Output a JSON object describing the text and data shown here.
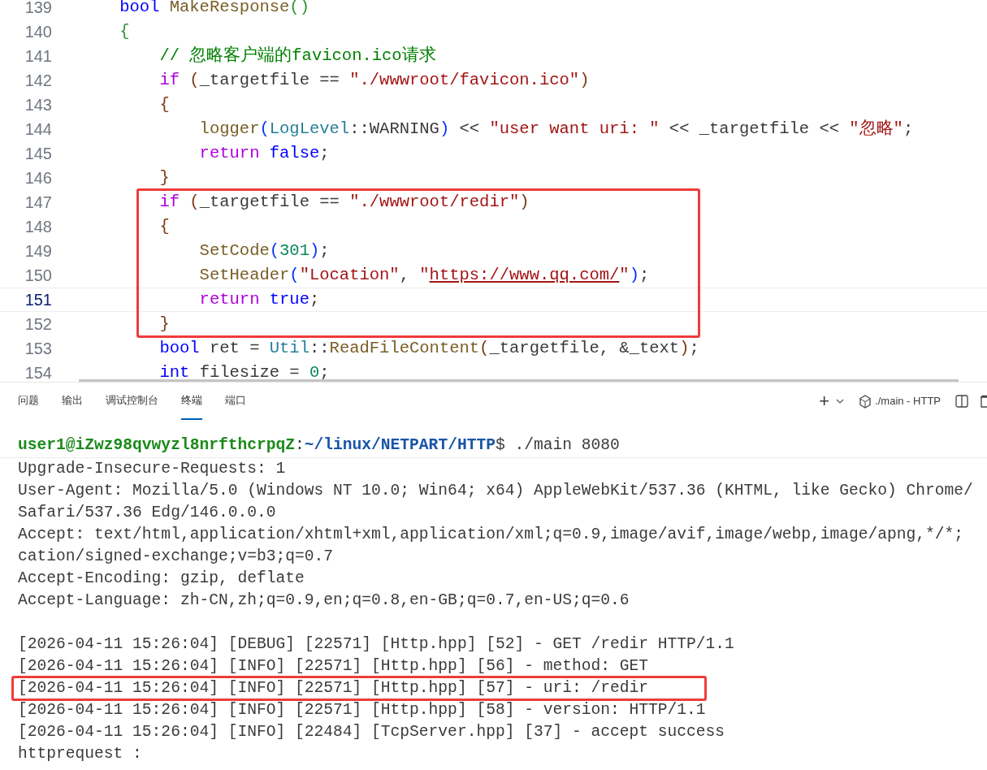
{
  "editor": {
    "lines": [
      {
        "number": "139",
        "current": false,
        "boxed": false,
        "tokens": [
          {
            "text": "    bool ",
            "kind": "keyword"
          },
          {
            "text": "MakeResponse",
            "kind": "function"
          },
          {
            "text": "()",
            "kind": "bracket-green"
          }
        ]
      },
      {
        "number": "140",
        "current": false,
        "boxed": false,
        "tokens": [
          {
            "text": "    {",
            "kind": "bracket-green"
          }
        ]
      },
      {
        "number": "141",
        "current": false,
        "boxed": false,
        "tokens": [
          {
            "text": "        // 忽略客户端的favicon.ico请求",
            "kind": "comment"
          }
        ]
      },
      {
        "number": "142",
        "current": false,
        "boxed": false,
        "tokens": [
          {
            "text": "        if ",
            "kind": "control"
          },
          {
            "text": "(",
            "kind": "bracket-brown"
          },
          {
            "text": "_targetfile == ",
            "kind": "plain"
          },
          {
            "text": "\"./wwwroot/favicon.ico\"",
            "kind": "string"
          },
          {
            "text": ")",
            "kind": "bracket-brown"
          }
        ]
      },
      {
        "number": "143",
        "current": false,
        "boxed": false,
        "tokens": [
          {
            "text": "        {",
            "kind": "bracket-brown"
          }
        ]
      },
      {
        "number": "144",
        "current": false,
        "boxed": false,
        "tokens": [
          {
            "text": "            logger",
            "kind": "function"
          },
          {
            "text": "(",
            "kind": "bracket-blue"
          },
          {
            "text": "LogLevel",
            "kind": "class"
          },
          {
            "text": "::WARNING",
            "kind": "plain"
          },
          {
            "text": ")",
            "kind": "bracket-blue"
          },
          {
            "text": " << ",
            "kind": "plain"
          },
          {
            "text": "\"user want uri: \"",
            "kind": "string"
          },
          {
            "text": " << _targetfile << ",
            "kind": "plain"
          },
          {
            "text": "\"忽略\"",
            "kind": "string"
          },
          {
            "text": ";",
            "kind": "plain"
          }
        ]
      },
      {
        "number": "145",
        "current": false,
        "boxed": false,
        "tokens": [
          {
            "text": "            return ",
            "kind": "control"
          },
          {
            "text": "false",
            "kind": "keyword"
          },
          {
            "text": ";",
            "kind": "plain"
          }
        ]
      },
      {
        "number": "146",
        "current": false,
        "boxed": false,
        "tokens": [
          {
            "text": "        }",
            "kind": "bracket-brown"
          }
        ]
      },
      {
        "number": "147",
        "current": false,
        "boxed": true,
        "tokens": [
          {
            "text": "        if ",
            "kind": "control"
          },
          {
            "text": "(",
            "kind": "bracket-brown"
          },
          {
            "text": "_targetfile == ",
            "kind": "plain"
          },
          {
            "text": "\"./wwwroot/redir\"",
            "kind": "string"
          },
          {
            "text": ")",
            "kind": "bracket-brown"
          }
        ]
      },
      {
        "number": "148",
        "current": false,
        "boxed": true,
        "tokens": [
          {
            "text": "        {",
            "kind": "bracket-brown"
          }
        ]
      },
      {
        "number": "149",
        "current": false,
        "boxed": true,
        "tokens": [
          {
            "text": "            SetCode",
            "kind": "function"
          },
          {
            "text": "(",
            "kind": "bracket-blue"
          },
          {
            "text": "301",
            "kind": "number"
          },
          {
            "text": ")",
            "kind": "bracket-blue"
          },
          {
            "text": ";",
            "kind": "plain"
          }
        ]
      },
      {
        "number": "150",
        "current": false,
        "boxed": true,
        "tokens": [
          {
            "text": "            SetHeader",
            "kind": "function"
          },
          {
            "text": "(",
            "kind": "bracket-blue"
          },
          {
            "text": "\"Location\"",
            "kind": "string"
          },
          {
            "text": ", ",
            "kind": "plain"
          },
          {
            "text": "\"",
            "kind": "string"
          },
          {
            "text": "https://www.qq.com/",
            "kind": "link"
          },
          {
            "text": "\"",
            "kind": "string"
          },
          {
            "text": ")",
            "kind": "bracket-blue"
          },
          {
            "text": ";",
            "kind": "plain"
          }
        ]
      },
      {
        "number": "151",
        "current": true,
        "boxed": true,
        "tokens": [
          {
            "text": "            return ",
            "kind": "control"
          },
          {
            "text": "true",
            "kind": "keyword"
          },
          {
            "text": ";",
            "kind": "plain"
          }
        ]
      },
      {
        "number": "152",
        "current": false,
        "boxed": true,
        "tokens": [
          {
            "text": "        }",
            "kind": "bracket-brown"
          }
        ]
      },
      {
        "number": "153",
        "current": false,
        "boxed": false,
        "tokens": [
          {
            "text": "        bool",
            "kind": "keyword"
          },
          {
            "text": " ret = ",
            "kind": "plain"
          },
          {
            "text": "Util",
            "kind": "class"
          },
          {
            "text": "::",
            "kind": "plain"
          },
          {
            "text": "ReadFileContent",
            "kind": "function"
          },
          {
            "text": "(",
            "kind": "bracket-brown"
          },
          {
            "text": "_targetfile, &_text",
            "kind": "plain"
          },
          {
            "text": ")",
            "kind": "bracket-brown"
          },
          {
            "text": ";",
            "kind": "plain"
          }
        ]
      },
      {
        "number": "154",
        "current": false,
        "boxed": false,
        "tokens": [
          {
            "text": "        int",
            "kind": "keyword"
          },
          {
            "text": " filesize = ",
            "kind": "plain"
          },
          {
            "text": "0",
            "kind": "number"
          },
          {
            "text": ";",
            "kind": "plain"
          }
        ]
      }
    ]
  },
  "panel": {
    "tabs": [
      {
        "label": "问题",
        "selected": false
      },
      {
        "label": "输出",
        "selected": false
      },
      {
        "label": "调试控制台",
        "selected": false
      },
      {
        "label": "终端",
        "selected": true
      },
      {
        "label": "端口",
        "selected": false
      }
    ],
    "add_button": "+",
    "terminal_name": "./main - HTTP"
  },
  "terminal": {
    "lines": [
      {
        "kind": "prompt",
        "boxed": false,
        "user": "user1@iZwz98qvwyzl8nrfthcrpqZ",
        "separator": ":",
        "path": "~/linux/NETPART/HTTP",
        "command": "$ ./main 8080"
      },
      {
        "kind": "text",
        "boxed": false,
        "text": "Upgrade-Insecure-Requests: 1"
      },
      {
        "kind": "text",
        "boxed": false,
        "text": "User-Agent: Mozilla/5.0 (Windows NT 10.0; Win64; x64) AppleWebKit/537.36 (KHTML, like Gecko) Chrome/"
      },
      {
        "kind": "text",
        "boxed": false,
        "text": "Safari/537.36 Edg/146.0.0.0"
      },
      {
        "kind": "text",
        "boxed": false,
        "text": "Accept: text/html,application/xhtml+xml,application/xml;q=0.9,image/avif,image/webp,image/apng,*/*;"
      },
      {
        "kind": "text",
        "boxed": false,
        "text": "cation/signed-exchange;v=b3;q=0.7"
      },
      {
        "kind": "text",
        "boxed": false,
        "text": "Accept-Encoding: gzip, deflate"
      },
      {
        "kind": "text",
        "boxed": false,
        "text": "Accept-Language: zh-CN,zh;q=0.9,en;q=0.8,en-GB;q=0.7,en-US;q=0.6"
      },
      {
        "kind": "blank",
        "boxed": false
      },
      {
        "kind": "text",
        "boxed": false,
        "text": "[2026-04-11 15:26:04] [DEBUG] [22571] [Http.hpp] [52] - GET /redir HTTP/1.1"
      },
      {
        "kind": "text",
        "boxed": false,
        "text": "[2026-04-11 15:26:04] [INFO] [22571] [Http.hpp] [56] - method: GET"
      },
      {
        "kind": "text",
        "boxed": true,
        "text": "[2026-04-11 15:26:04] [INFO] [22571] [Http.hpp] [57] - uri: /redir"
      },
      {
        "kind": "text",
        "boxed": false,
        "text": "[2026-04-11 15:26:04] [INFO] [22571] [Http.hpp] [58] - version: HTTP/1.1"
      },
      {
        "kind": "text",
        "boxed": false,
        "text": "[2026-04-11 15:26:04] [INFO] [22484] [TcpServer.hpp] [37] - accept success"
      },
      {
        "kind": "text",
        "boxed": false,
        "text": "httprequest :"
      }
    ]
  }
}
